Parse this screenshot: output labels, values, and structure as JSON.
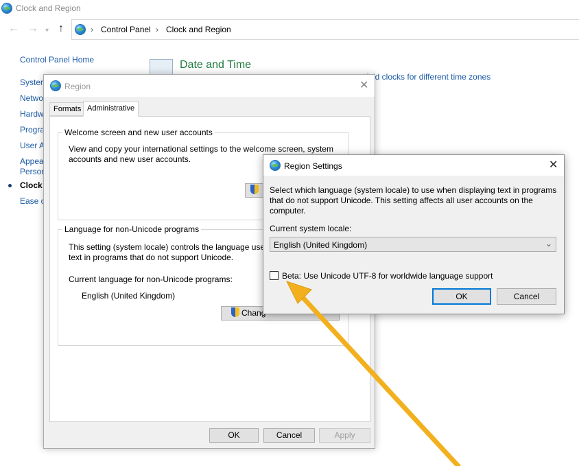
{
  "window": {
    "title": "Clock and Region"
  },
  "breadcrumb": {
    "items": [
      "Control Panel",
      "Clock and Region"
    ]
  },
  "left_nav": {
    "items": [
      {
        "label": "Control Panel Home",
        "active": false
      },
      {
        "label": "System",
        "active": false
      },
      {
        "label": "Netwo",
        "active": false
      },
      {
        "label": "Hardw",
        "active": false
      },
      {
        "label": "Progra",
        "active": false
      },
      {
        "label": "User A",
        "active": false
      },
      {
        "label": "Appea",
        "active": false
      },
      {
        "label": "Person",
        "active": false
      },
      {
        "label": "Clock a",
        "active": true
      },
      {
        "label": "Ease of",
        "active": false
      }
    ]
  },
  "main": {
    "section_title": "Date and Time",
    "link_add_clocks": "Add clocks for different time zones"
  },
  "region_dialog": {
    "title": "Region",
    "tabs": [
      "Formats",
      "Administrative"
    ],
    "active_tab": "Administrative",
    "welcome_group": {
      "title": "Welcome screen and new user accounts",
      "description": "View and copy your international settings to the welcome screen, system accounts and new user accounts."
    },
    "nonunicode_group": {
      "title": "Language for non-Unicode programs",
      "description": "This setting (system locale) controls the language used text in programs that do not support Unicode.",
      "current_label": "Current language for non-Unicode programs:",
      "current_value": "English (United Kingdom)",
      "change_button": "Chang"
    },
    "buttons": {
      "ok": "OK",
      "cancel": "Cancel",
      "apply": "Apply"
    }
  },
  "region_settings_dialog": {
    "title": "Region Settings",
    "description": "Select which language (system locale) to use when displaying text in programs that do not support Unicode. This setting affects all user accounts on the computer.",
    "locale_label": "Current system locale:",
    "locale_value": "English (United Kingdom)",
    "beta_label": "Beta: Use Unicode UTF-8 for worldwide language support",
    "beta_checked": false,
    "buttons": {
      "ok": "OK",
      "cancel": "Cancel"
    }
  },
  "annotation": {
    "arrow_color": "#f2b01e"
  }
}
